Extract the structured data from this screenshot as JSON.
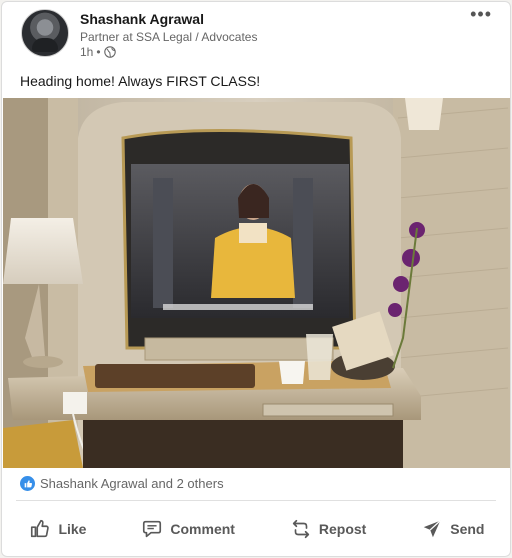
{
  "post": {
    "author": {
      "name": "Shashank Agrawal",
      "headline": "Partner at SSA Legal / Advocates"
    },
    "time": "1h",
    "meta_separator": "•",
    "more_label": "•••",
    "text": "Heading home! Always FIRST CLASS!",
    "image_icons": [
      "globe-icon"
    ]
  },
  "reactions": {
    "summary": "Shashank Agrawal and 2 others",
    "icon": "like-reaction-icon"
  },
  "actions": [
    {
      "label": "Like",
      "icon": "thumbs-up-icon"
    },
    {
      "label": "Comment",
      "icon": "comment-icon"
    },
    {
      "label": "Repost",
      "icon": "repost-icon"
    },
    {
      "label": "Send",
      "icon": "send-icon"
    }
  ],
  "colors": {
    "reaction_blue": "#378fe9",
    "secondary_text": "#666666",
    "action_text": "#595959"
  }
}
